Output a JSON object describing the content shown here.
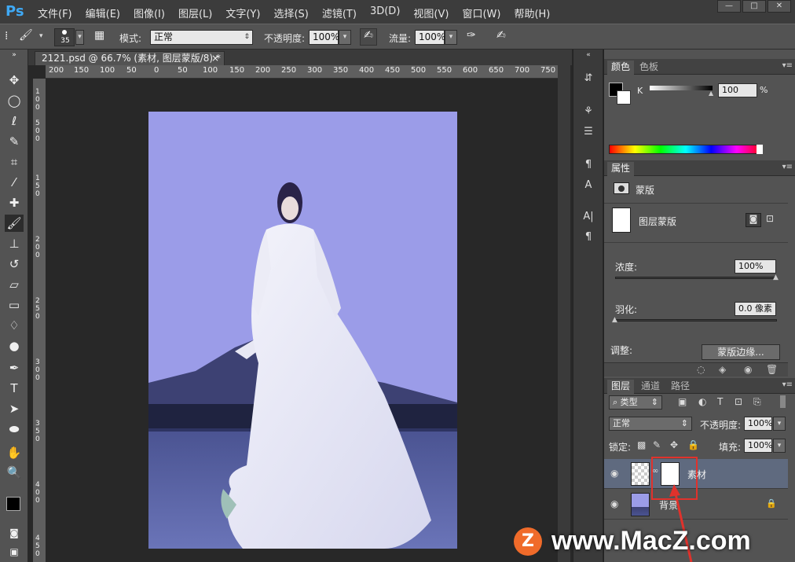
{
  "app": {
    "logo": "Ps"
  },
  "menu": [
    "文件(F)",
    "编辑(E)",
    "图像(I)",
    "图层(L)",
    "文字(Y)",
    "选择(S)",
    "滤镜(T)",
    "3D(D)",
    "视图(V)",
    "窗口(W)",
    "帮助(H)"
  ],
  "window_controls": {
    "minimize": "—",
    "restore": "□",
    "close": "✕"
  },
  "options_bar": {
    "brush_size": "35",
    "mode_label": "模式:",
    "mode_value": "正常",
    "opacity_label": "不透明度:",
    "opacity_value": "100%",
    "flow_label": "流量:",
    "flow_value": "100%"
  },
  "document": {
    "tab_title": "2121.psd @ 66.7% (素材, 图层蒙版/8) *",
    "close": "×",
    "ruler_top": [
      "200",
      "150",
      "100",
      "50",
      "0",
      "50",
      "100",
      "150",
      "200",
      "250",
      "300",
      "350",
      "400",
      "450",
      "500",
      "550",
      "600",
      "650",
      "700",
      "750"
    ],
    "ruler_left": [
      "1",
      "0",
      "0",
      "5",
      "0",
      "0",
      "1",
      "5",
      "0",
      "2",
      "0",
      "0",
      "2",
      "5",
      "0",
      "3",
      "0",
      "0",
      "3",
      "5",
      "0",
      "4",
      "0",
      "0",
      "4",
      "5",
      "0"
    ]
  },
  "color_panel": {
    "tab_color": "颜色",
    "tab_swatches": "色板",
    "channel": "K",
    "value": "100",
    "unit": "%"
  },
  "properties_panel": {
    "tab": "属性",
    "mask_title": "蒙版",
    "layer_mask_label": "图层蒙版",
    "density_label": "浓度:",
    "density_value": "100%",
    "feather_label": "羽化:",
    "feather_value": "0.0 像素",
    "adjust_label": "调整:",
    "mask_edge_button": "蒙版边缘..."
  },
  "layers_panel": {
    "tab_layers": "图层",
    "tab_channels": "通道",
    "tab_paths": "路径",
    "filter_type": "类型",
    "blend_mode": "正常",
    "opacity_label": "不透明度:",
    "opacity_value": "100%",
    "lock_label": "锁定:",
    "fill_label": "填充:",
    "fill_value": "100%",
    "layers": [
      {
        "name": "素材",
        "selected": true
      },
      {
        "name": "背景",
        "selected": false
      }
    ]
  },
  "watermark": {
    "text": "www.MacZ.com",
    "logo": "Z"
  },
  "colors": {
    "accent_blue": "#3fa9f5",
    "highlight_red": "#e0322c",
    "canvas_bg": "#9b9ce8"
  }
}
